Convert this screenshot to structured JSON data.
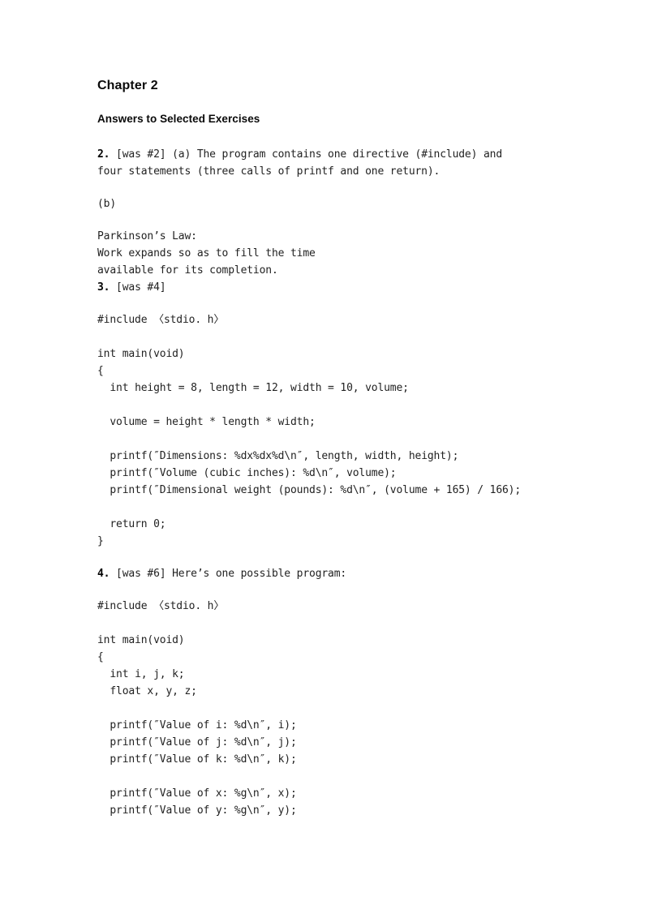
{
  "document": {
    "chapter_heading": "Chapter 2",
    "section_heading": "Answers to Selected Exercises"
  },
  "answers": [
    {
      "number": "2.",
      "body_lines": [
        " [was #2] (a) The program contains one directive (#include) and",
        "four statements (three calls of printf and one return)."
      ],
      "part_b_label": "(b)",
      "quote_lines": [
        "Parkinson’s Law:",
        "Work expands so as to fill the time",
        "available for its completion."
      ]
    },
    {
      "number": "3.",
      "body_lines": [
        " [was #4]"
      ],
      "code_lines": [
        "#include 〈stdio. h〉",
        "",
        "int main(void)",
        "{",
        "  int height = 8, length = 12, width = 10, volume;",
        "",
        "  volume = height * length * width;",
        "",
        "  printf(″Dimensions: %dx%dx%d\\n″, length, width, height);",
        "  printf(″Volume (cubic inches): %d\\n″, volume);",
        "  printf(″Dimensional weight (pounds): %d\\n″, (volume + 165) / 166);",
        "",
        "  return 0;",
        "}"
      ]
    },
    {
      "number": "4.",
      "body_lines": [
        " [was #6] Here’s one possible program:"
      ],
      "code_lines": [
        "#include 〈stdio. h〉",
        "",
        "int main(void)",
        "{",
        "  int i, j, k;",
        "  float x, y, z;",
        "",
        "  printf(″Value of i: %d\\n″, i);",
        "  printf(″Value of j: %d\\n″, j);",
        "  printf(″Value of k: %d\\n″, k);",
        "",
        "  printf(″Value of x: %g\\n″, x);",
        "  printf(″Value of y: %g\\n″, y);"
      ]
    }
  ]
}
